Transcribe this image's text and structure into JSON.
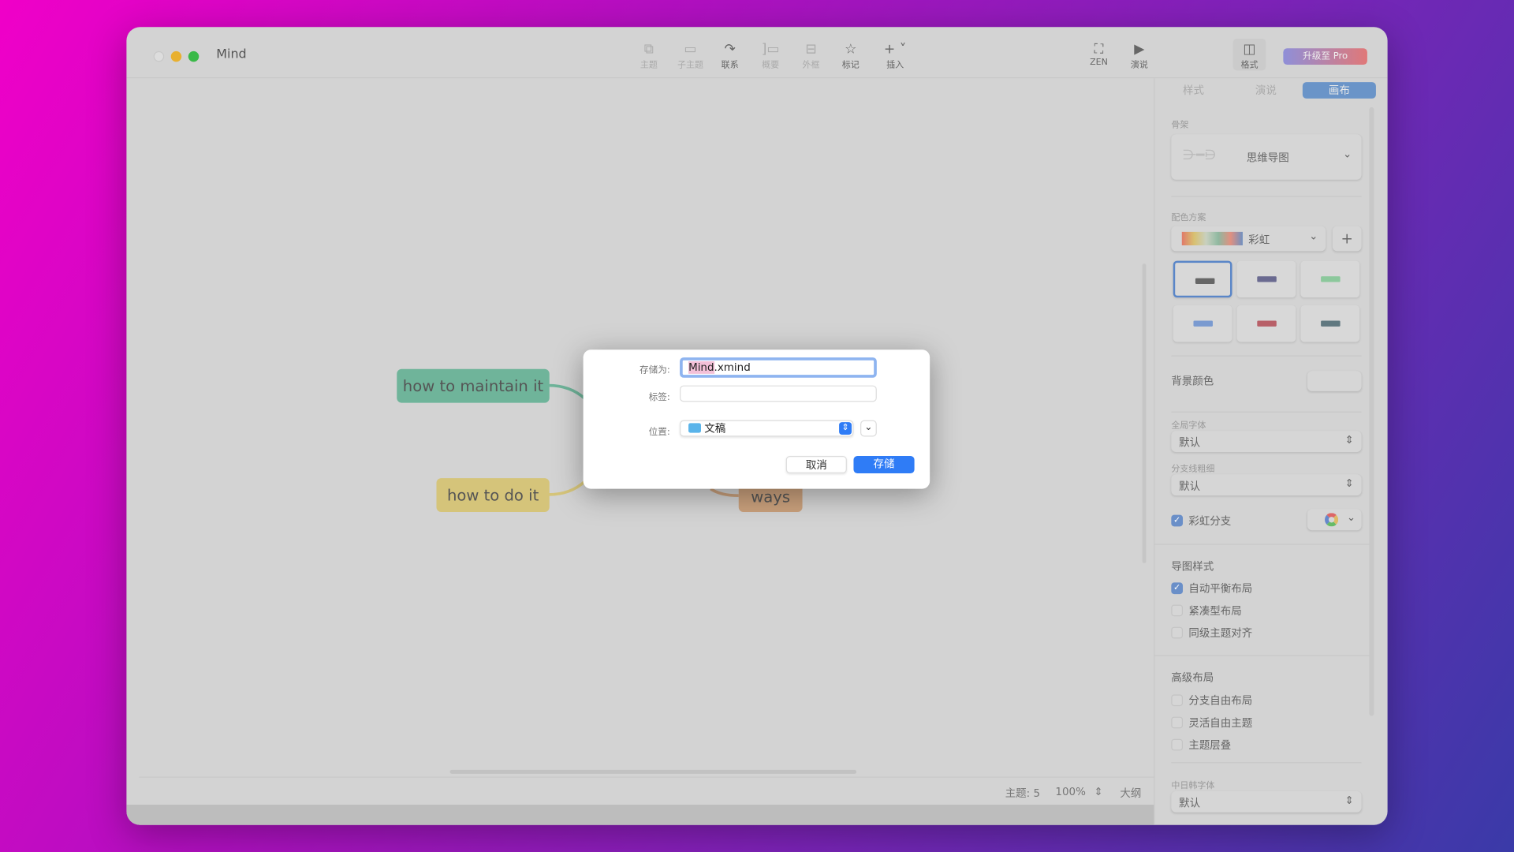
{
  "window": {
    "title": "Mind"
  },
  "toolbar": {
    "items": [
      {
        "label": "主题",
        "icon": "topic-icon",
        "enabled": false
      },
      {
        "label": "子主题",
        "icon": "subtopic-icon",
        "enabled": false
      },
      {
        "label": "联系",
        "icon": "relationship-icon",
        "enabled": true
      },
      {
        "label": "概要",
        "icon": "summary-icon",
        "enabled": false
      },
      {
        "label": "外框",
        "icon": "boundary-icon",
        "enabled": false
      },
      {
        "label": "标记",
        "icon": "star-icon",
        "enabled": true
      },
      {
        "label": "插入",
        "icon": "plus-icon",
        "enabled": true
      }
    ],
    "zen": "ZEN",
    "present": "演说",
    "format": "格式",
    "upgrade": "升级至 Pro"
  },
  "canvas": {
    "nodes": [
      "how to maintain it",
      "how to do it",
      "ways"
    ]
  },
  "status": {
    "topics": "主题: 5",
    "zoom": "100%",
    "outline": "大纲"
  },
  "panel": {
    "tabs": [
      "样式",
      "演说",
      "画布"
    ],
    "active_tab": "画布",
    "skeleton_label": "骨架",
    "skeleton_value": "思维导图",
    "scheme_label": "配色方案",
    "scheme_value": "彩虹",
    "bg_color_label": "背景颜色",
    "global_font_label": "全局字体",
    "global_font_value": "默认",
    "branch_width_label": "分支线粗细",
    "branch_width_value": "默认",
    "rainbow_branch": {
      "label": "彩虹分支",
      "checked": true
    },
    "map_style_label": "导图样式",
    "map_style": [
      {
        "label": "自动平衡布局",
        "checked": true
      },
      {
        "label": "紧凑型布局",
        "checked": false
      },
      {
        "label": "同级主题对齐",
        "checked": false
      }
    ],
    "advanced_label": "高级布局",
    "advanced": [
      {
        "label": "分支自由布局",
        "checked": false
      },
      {
        "label": "灵活自由主题",
        "checked": false
      },
      {
        "label": "主题层叠",
        "checked": false
      }
    ],
    "cjk_font_label": "中日韩字体",
    "cjk_font_value": "默认"
  },
  "dialog": {
    "save_as_label": "存储为:",
    "save_as_value": "Mind.xmind",
    "save_as_selected": "Mind",
    "tags_label": "标签:",
    "tags_value": "",
    "location_label": "位置:",
    "location_value": "文稿",
    "cancel": "取消",
    "save": "存储"
  },
  "colors": {
    "accent": "#2f7cf6",
    "upgrade_start": "#8f8fd8",
    "upgrade_end": "#e07878",
    "node_green": "#6fb49a",
    "node_yellow": "#d5c47a",
    "node_orange": "#c9a07c"
  }
}
